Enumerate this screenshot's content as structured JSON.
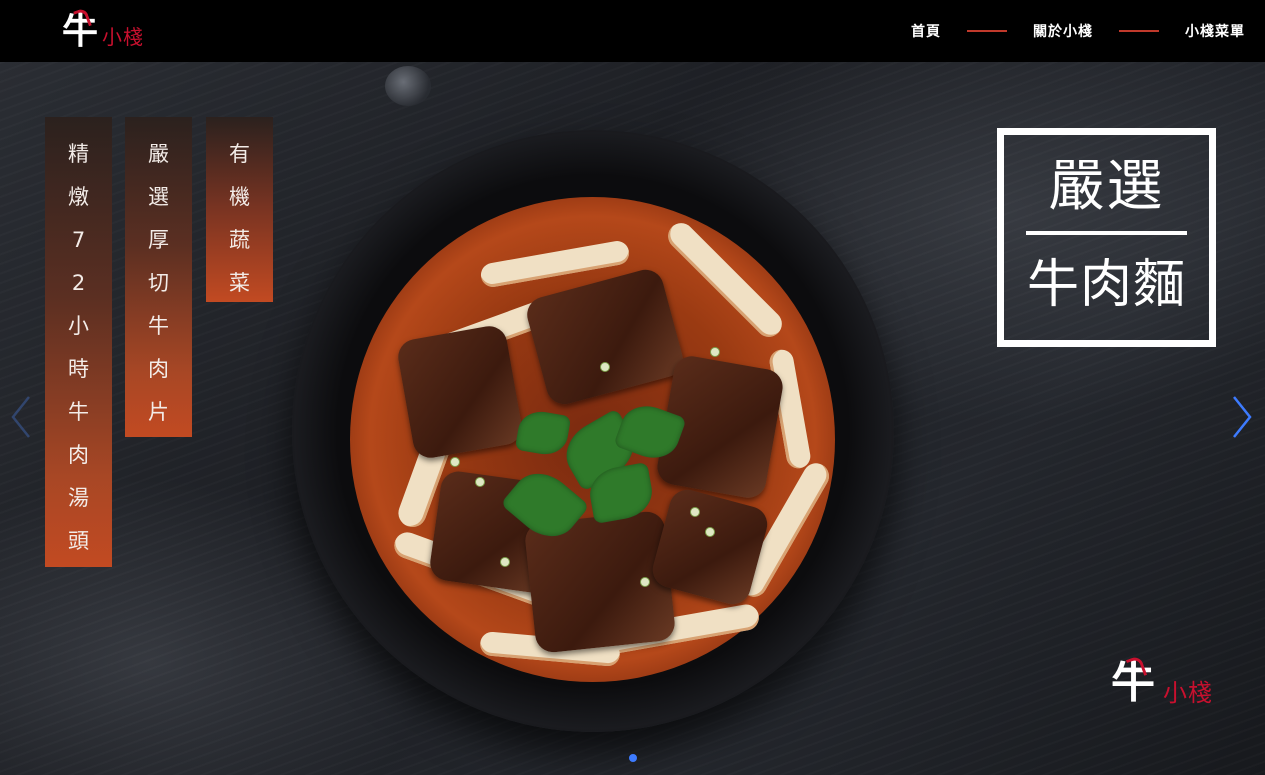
{
  "header": {
    "logo": {
      "glyph": "牛",
      "text": "小棧"
    },
    "nav": [
      {
        "label": "首頁"
      },
      {
        "label": "關於小棧"
      },
      {
        "label": "小棧菜單"
      }
    ],
    "accent_color": "#c0392b"
  },
  "hero": {
    "banners": [
      {
        "text": "精燉72小時牛肉湯頭"
      },
      {
        "text": "嚴選厚切牛肉片"
      },
      {
        "text": "有機蔬菜"
      }
    ],
    "title_box": {
      "line1": "嚴選",
      "line2": "牛肉麵"
    },
    "corner_logo": {
      "glyph": "牛",
      "text": "小棧"
    },
    "prev_icon": "chevron-left-icon",
    "next_icon": "chevron-right-icon",
    "slides": 1,
    "active_slide": 1,
    "dot_color": "#3d7bff"
  }
}
